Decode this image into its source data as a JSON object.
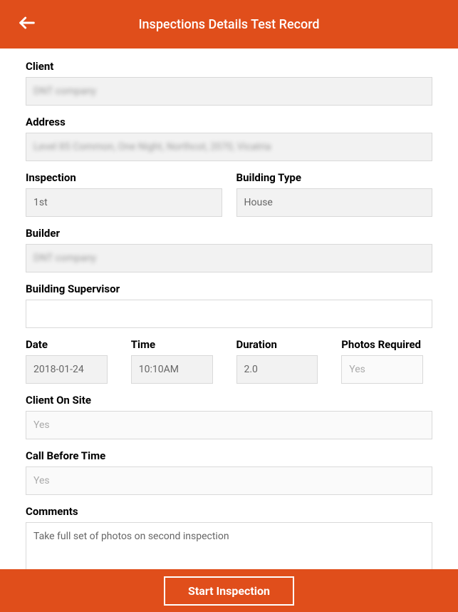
{
  "header": {
    "title": "Inspections Details Test Record"
  },
  "fields": {
    "client": {
      "label": "Client",
      "value": "DNT company"
    },
    "address": {
      "label": "Address",
      "value": "Level 85 Common, One Night, Northcot, 2070, Vicatria"
    },
    "inspection": {
      "label": "Inspection",
      "value": "1st"
    },
    "buildingType": {
      "label": "Building Type",
      "value": "House"
    },
    "builder": {
      "label": "Builder",
      "value": "DNT company"
    },
    "buildingSupervisor": {
      "label": "Building Supervisor",
      "value": ""
    },
    "date": {
      "label": "Date",
      "value": "2018-01-24"
    },
    "time": {
      "label": "Time",
      "value": "10:10AM"
    },
    "duration": {
      "label": "Duration",
      "value": "2.0"
    },
    "photosRequired": {
      "label": "Photos Required",
      "value": "Yes"
    },
    "clientOnSite": {
      "label": "Client On Site",
      "value": "Yes"
    },
    "callBeforeTime": {
      "label": "Call Before Time",
      "value": "Yes"
    },
    "comments": {
      "label": "Comments",
      "value": "Take full set of photos on second inspection"
    }
  },
  "footer": {
    "startButton": "Start Inspection"
  }
}
